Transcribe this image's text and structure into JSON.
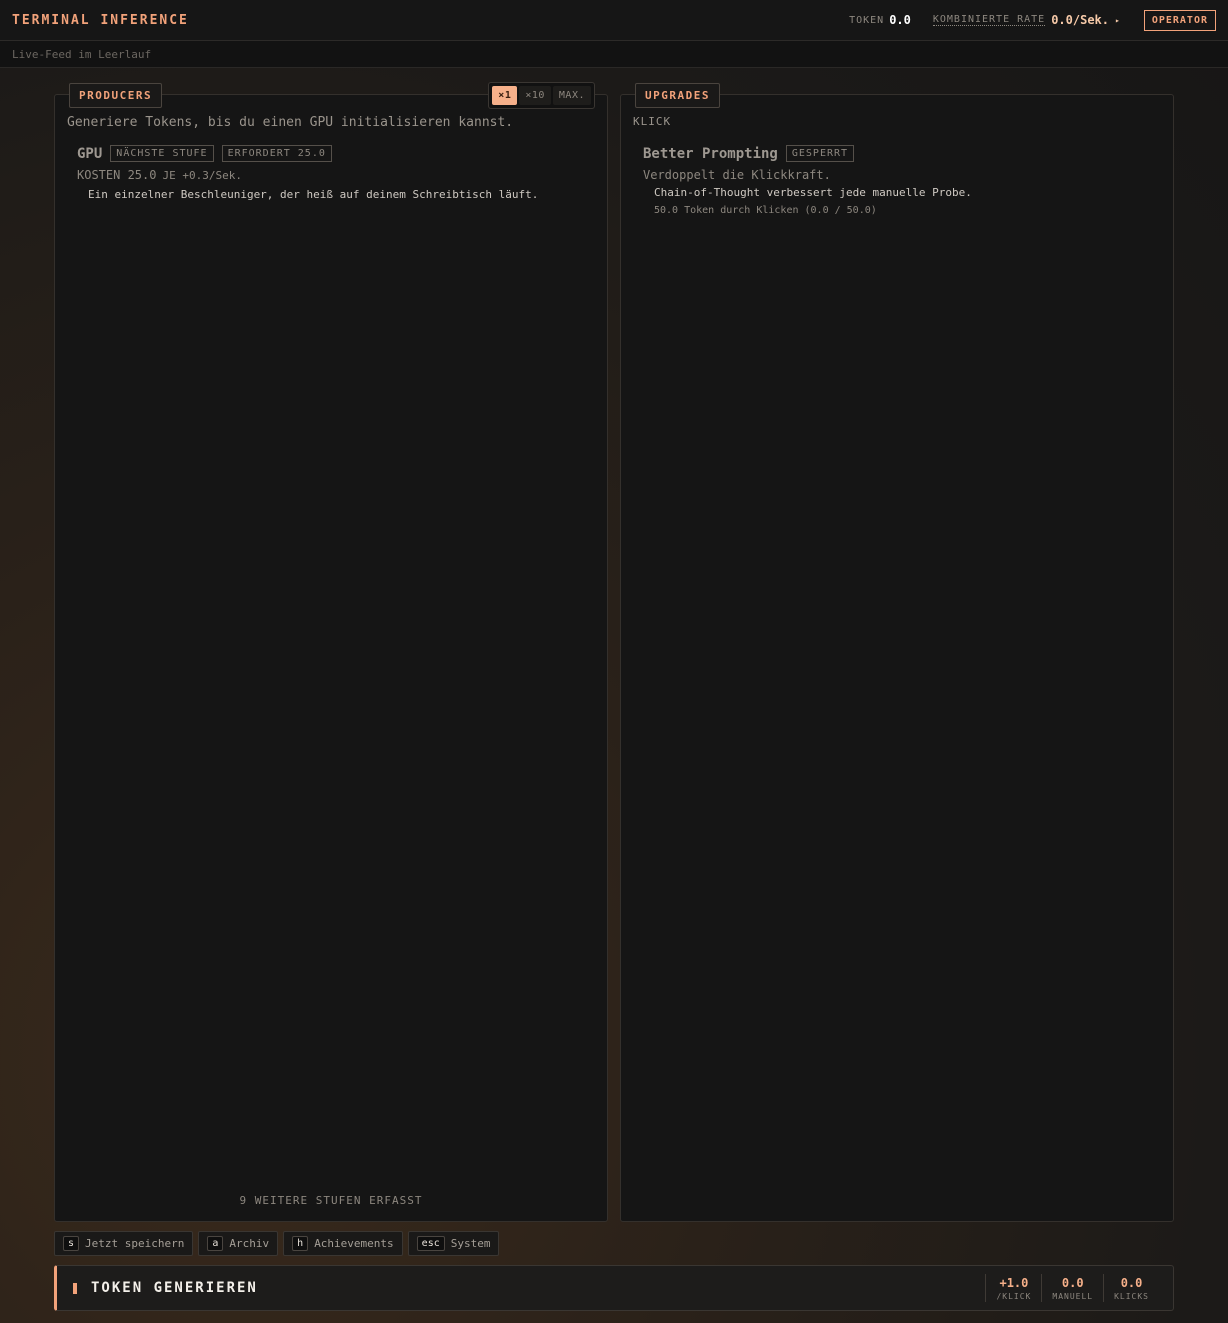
{
  "header": {
    "title": "TERMINAL INFERENCE",
    "token_label": "TOKEN",
    "token_value": "0.0",
    "rate_label": "KOMBINIERTE RATE",
    "rate_value": "0.0/Sek.",
    "rate_arrow": "▸",
    "operator_label": "OPERATOR"
  },
  "status": {
    "feed": "Live-Feed im Leerlauf"
  },
  "producers": {
    "tab": "PRODUCERS",
    "multipliers": [
      "×1",
      "×10",
      "MAX."
    ],
    "active_multiplier": "×1",
    "hint": "Generiere Tokens, bis du einen GPU initialisieren kannst.",
    "item": {
      "name": "GPU",
      "tag_next": "NÄCHSTE STUFE",
      "tag_requires": "ERFORDERT 25.0",
      "cost": "KOSTEN 25.0",
      "per": "JE +0.3/Sek.",
      "description": "Ein einzelner Beschleuniger, der heiß auf deinem Schreibtisch läuft."
    },
    "more_tiers": "9 WEITERE STUFEN ERFASST"
  },
  "upgrades": {
    "tab": "UPGRADES",
    "section": "KLICK",
    "item": {
      "name": "Better Prompting",
      "tag": "GESPERRT",
      "description": "Verdoppelt die Klickkraft.",
      "flavor": "Chain-of-Thought verbessert jede manuelle Probe.",
      "requirement": "50.0 Token durch Klicken (0.0 / 50.0)"
    }
  },
  "hotkeys": [
    {
      "key": "s",
      "label": "Jetzt speichern"
    },
    {
      "key": "a",
      "label": "Archiv"
    },
    {
      "key": "h",
      "label": "Achievements"
    },
    {
      "key": "esc",
      "label": "System"
    }
  ],
  "generate": {
    "label": "TOKEN GENERIEREN",
    "stats": [
      {
        "value": "+1.0",
        "label": "/KLICK"
      },
      {
        "value": "0.0",
        "label": "MANUELL"
      },
      {
        "value": "0.0",
        "label": "KLICKS"
      }
    ]
  },
  "colors": {
    "accent": "#f2a27a",
    "background": "#151515"
  }
}
